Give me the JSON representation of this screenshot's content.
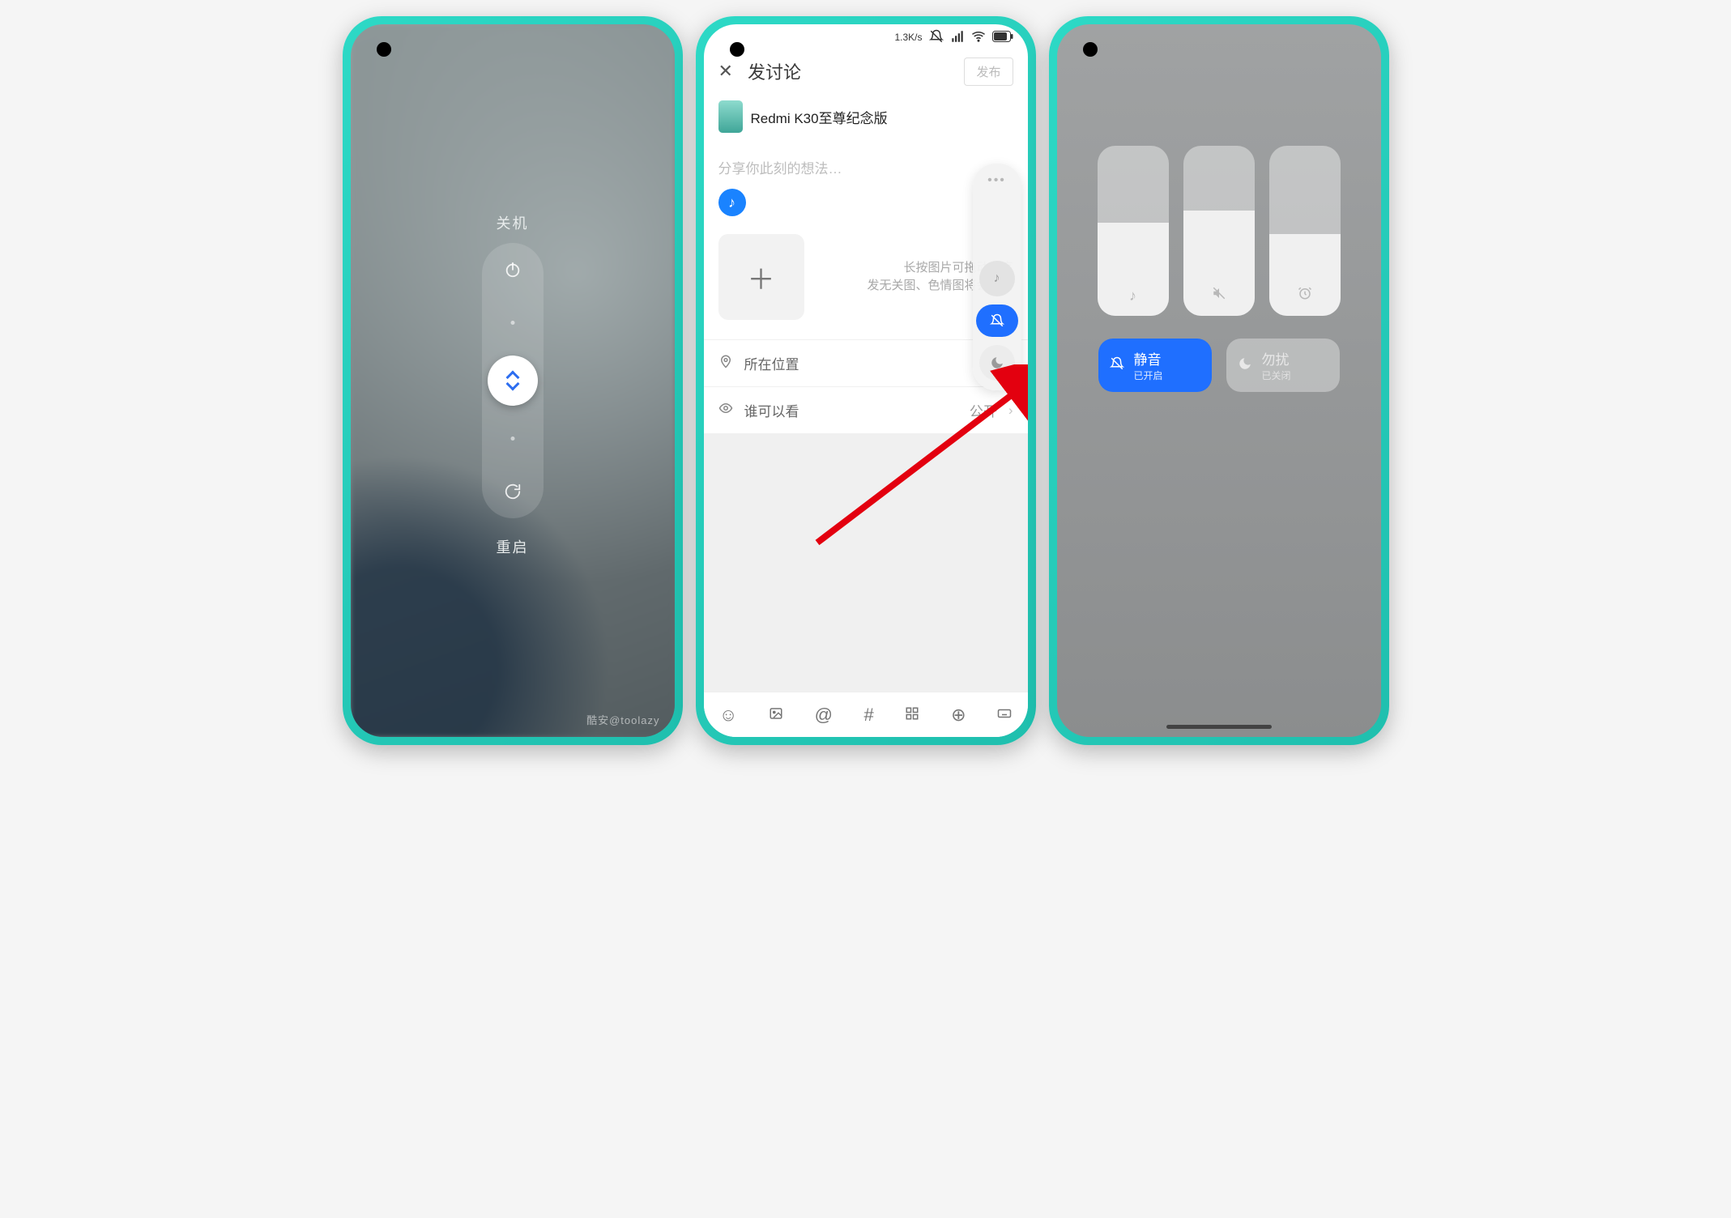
{
  "phone1": {
    "power_off_label": "关机",
    "restart_label": "重启",
    "watermark": "酷安@toolazy"
  },
  "phone2": {
    "status_speed": "1.3K/s",
    "header_title": "发讨论",
    "publish_label": "发布",
    "device_name": "Redmi K30至尊纪念版",
    "placeholder": "分享你此刻的想法…",
    "hint_line1": "长按图片可拖动排序",
    "hint_line2": "发无关图、色情图将会被禁",
    "location_label": "所在位置",
    "visibility_label": "谁可以看",
    "visibility_value": "公开"
  },
  "phone3": {
    "sliders": [
      {
        "name": "media",
        "fill": 55
      },
      {
        "name": "ring",
        "fill": 62
      },
      {
        "name": "alarm",
        "fill": 48
      }
    ],
    "mute_title": "静音",
    "mute_status": "已开启",
    "dnd_title": "勿扰",
    "dnd_status": "已关闭"
  }
}
